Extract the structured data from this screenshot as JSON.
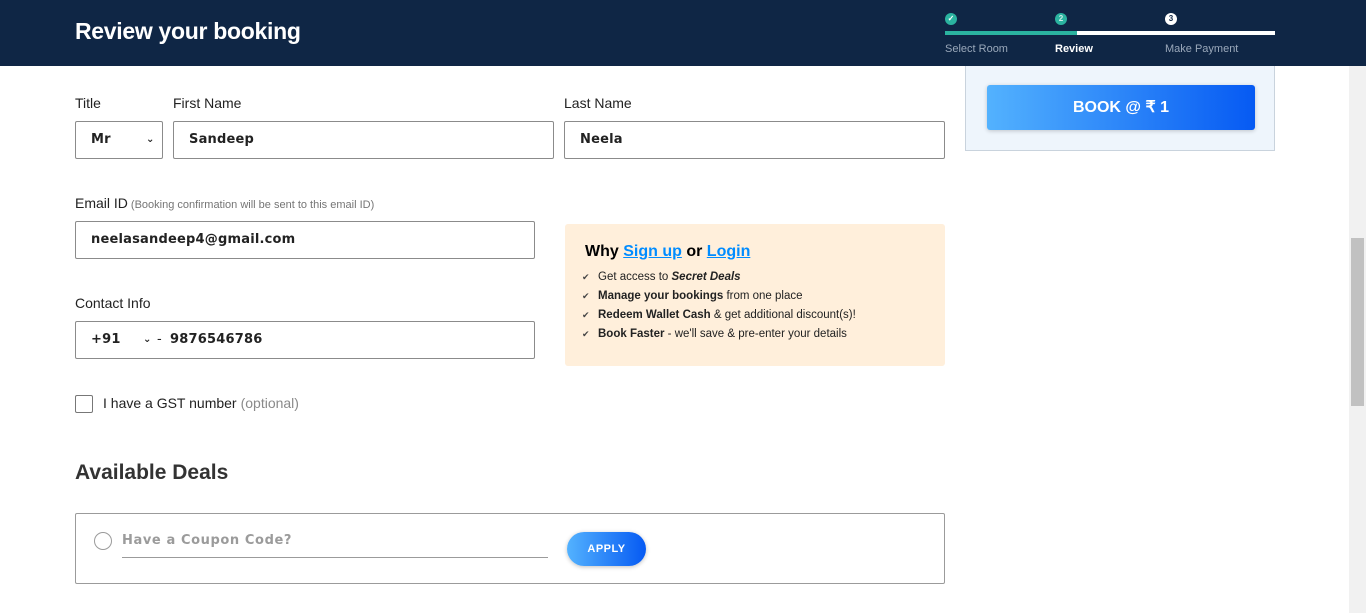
{
  "header": {
    "title": "Review your booking",
    "steps": [
      {
        "number": "✓",
        "label": "Select Room",
        "state": "done"
      },
      {
        "number": "2",
        "label": "Review",
        "state": "active"
      },
      {
        "number": "3",
        "label": "Make Payment",
        "state": "todo"
      }
    ],
    "progress_fraction": 0.4
  },
  "booking": {
    "book_label": "BOOK @ ₹ 1"
  },
  "form": {
    "title_label": "Title",
    "title_value": "Mr",
    "first_name_label": "First Name",
    "first_name_value": "Sandeep",
    "last_name_label": "Last Name",
    "last_name_value": "Neela",
    "email_label": "Email ID",
    "email_hint": "(Booking confirmation will be sent to this email ID)",
    "email_value": "neelasandeep4@gmail.com",
    "contact_label": "Contact Info",
    "country_code": "+91",
    "separator": "-",
    "phone_value": "9876546786",
    "gst_label": "I have a GST number",
    "gst_optional": "(optional)",
    "gst_checked": false
  },
  "signup": {
    "prefix": "Why",
    "signup_link": "Sign up",
    "or": "or",
    "login_link": "Login",
    "benefits": [
      {
        "pre": "Get access to ",
        "bold": "Secret Deals",
        "post": ""
      },
      {
        "pre": "",
        "bold": "Manage your bookings",
        "post": " from one place"
      },
      {
        "pre": "",
        "bold": "Redeem Wallet Cash",
        "post": " & get additional discount(s)!"
      },
      {
        "pre": "",
        "bold": "Book Faster",
        "post": " - we'll save & pre-enter your details"
      }
    ]
  },
  "deals": {
    "title": "Available Deals",
    "coupon_placeholder": "Have a Coupon Code?",
    "apply_label": "APPLY"
  },
  "colors": {
    "header_bg": "#0f2645",
    "accent_teal": "#2bb3a0",
    "link_blue": "#008cff",
    "button_gradient_start": "#53b2fe",
    "button_gradient_end": "#065af3",
    "signup_bg": "#ffefdb"
  },
  "icons": {
    "step_done": "check-icon",
    "select_chevron": "chevron-down-icon",
    "benefit": "check-icon"
  }
}
